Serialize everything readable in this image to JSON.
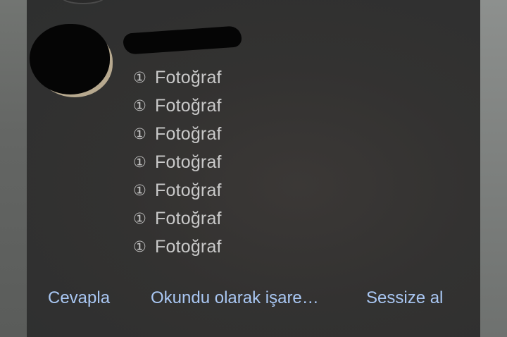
{
  "notification": {
    "messages": [
      {
        "icon": "①",
        "text": "Fotoğraf"
      },
      {
        "icon": "①",
        "text": "Fotoğraf"
      },
      {
        "icon": "①",
        "text": "Fotoğraf"
      },
      {
        "icon": "①",
        "text": "Fotoğraf"
      },
      {
        "icon": "①",
        "text": "Fotoğraf"
      },
      {
        "icon": "①",
        "text": "Fotoğraf"
      },
      {
        "icon": "①",
        "text": "Fotoğraf"
      }
    ],
    "actions": {
      "reply_label": "Cevapla",
      "mark_read_label": "Okundu olarak işare…",
      "mute_label": "Sessize al"
    }
  },
  "colors": {
    "action_text": "#a9c7f3",
    "message_text": "#c9c9c9",
    "card_background": "#333231"
  }
}
